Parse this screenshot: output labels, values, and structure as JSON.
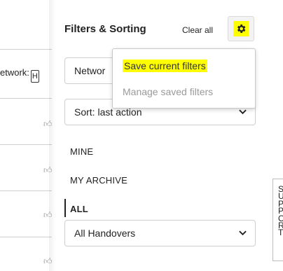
{
  "background": {
    "network_label": "etwork:",
    "network_box_char": "H"
  },
  "panel": {
    "title": "Filters & Sorting",
    "clear_all": "Clear all",
    "network_select": "Networ",
    "sort_select": "Sort: last action",
    "nav": [
      "MINE",
      "MY ARCHIVE",
      "ALL"
    ],
    "active_nav": "ALL",
    "handovers_select": "All Handovers"
  },
  "dropdown": {
    "items": [
      "Save current filters",
      "Manage saved filters"
    ]
  },
  "side_tip": {
    "letters": [
      "S",
      "U",
      "P",
      "P",
      "O",
      "R",
      "T"
    ]
  },
  "colors": {
    "highlight": "#ffff00",
    "disabled_text": "#9a9a9a"
  },
  "icons": {
    "gear": "gear-icon",
    "chevron": "chevron-down-icon",
    "thumb": "thumbs-up-icon"
  }
}
